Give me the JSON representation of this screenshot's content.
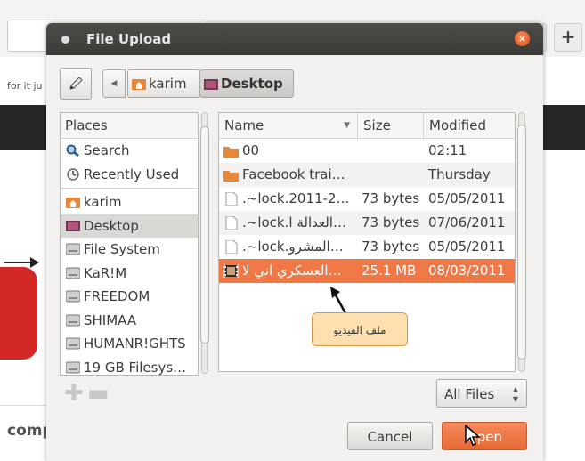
{
  "background": {
    "partial_text": "for it ju",
    "bottom_text": "comp",
    "plus_label": "+"
  },
  "dialog": {
    "title": "File Upload",
    "close_glyph": "×",
    "breadcrumbs": [
      {
        "label": "karim",
        "icon": "home-folder-icon"
      },
      {
        "label": "Desktop",
        "icon": "desktop-icon"
      }
    ],
    "places": {
      "header": "Places",
      "items": [
        {
          "label": "Search",
          "icon": "search-icon"
        },
        {
          "label": "Recently Used",
          "icon": "recent-icon"
        },
        {
          "label": "karim",
          "icon": "home-folder-icon"
        },
        {
          "label": "Desktop",
          "icon": "desktop-icon",
          "selected": true
        },
        {
          "label": "File System",
          "icon": "drive-icon"
        },
        {
          "label": "KaR!M",
          "icon": "drive-icon"
        },
        {
          "label": "FREEDOM",
          "icon": "drive-icon"
        },
        {
          "label": "SHIMAA",
          "icon": "drive-icon"
        },
        {
          "label": "HUMANR!GHTS",
          "icon": "drive-icon"
        },
        {
          "label": "19 GB Filesys…",
          "icon": "drive-icon"
        }
      ]
    },
    "files": {
      "columns": {
        "name": "Name",
        "size": "Size",
        "modified": "Modified"
      },
      "rows": [
        {
          "name": "00",
          "size": "",
          "modified": "02:11",
          "icon": "folder-icon"
        },
        {
          "name": "Facebook trai…",
          "size": "",
          "modified": "Thursday",
          "icon": "folder-icon"
        },
        {
          "name": ".~lock.2011-2…",
          "size": "73 bytes",
          "modified": "05/05/2011",
          "icon": "file-icon"
        },
        {
          "name": ".~lock.العدالة ا…",
          "size": "73 bytes",
          "modified": "07/06/2011",
          "icon": "file-icon"
        },
        {
          "name": ".~lock.المشرو…",
          "size": "73 bytes",
          "modified": "05/05/2011",
          "icon": "file-icon"
        },
        {
          "name": "العسكري اني لا…",
          "size": "25.1 MB",
          "modified": "08/03/2011",
          "icon": "video-file-icon",
          "selected": true
        }
      ]
    },
    "annotation": "ملف الفيديو",
    "filter": {
      "selected": "All Files"
    },
    "buttons": {
      "cancel": "Cancel",
      "open": "Open"
    },
    "colors": {
      "accent": "#f07746",
      "titlebar": "#3f3e3a",
      "callout": "#fddfb0"
    }
  }
}
